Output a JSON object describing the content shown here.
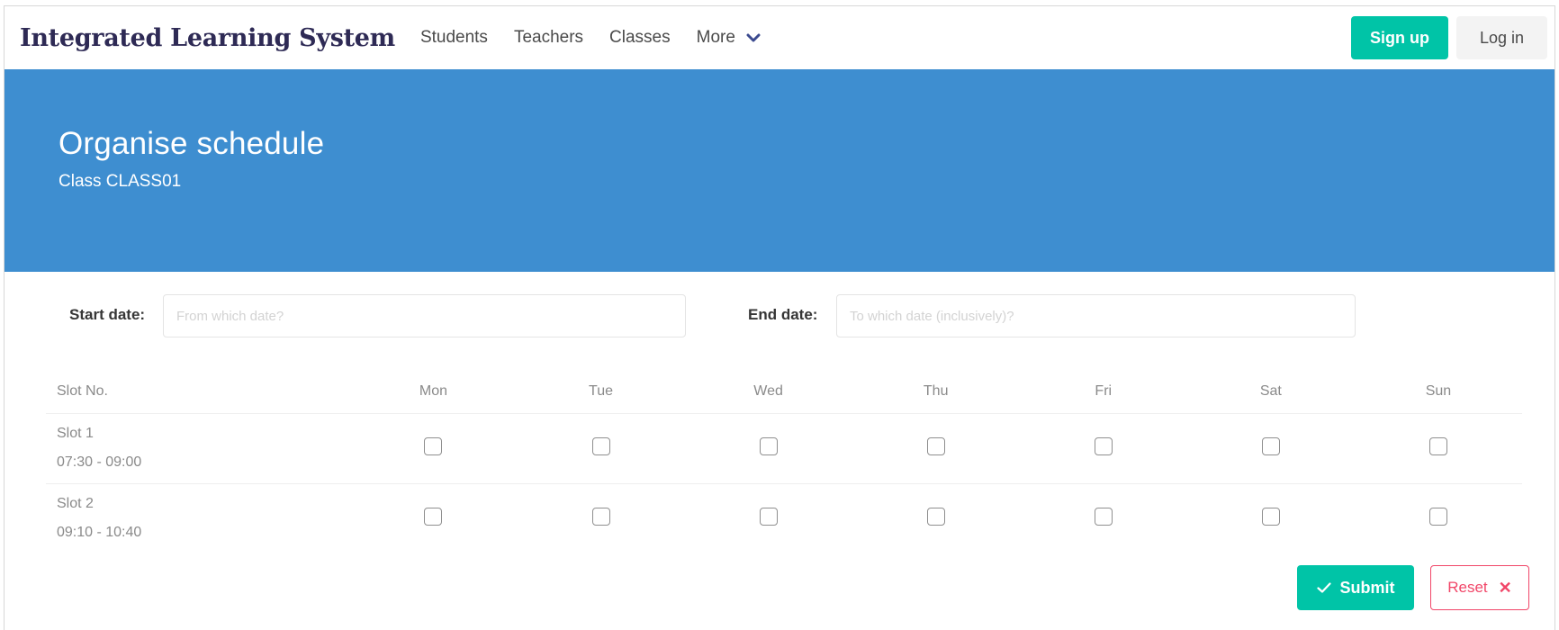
{
  "navbar": {
    "brand": "Integrated Learning System",
    "links": [
      "Students",
      "Teachers",
      "Classes"
    ],
    "more_label": "More",
    "signup_label": "Sign up",
    "login_label": "Log in"
  },
  "hero": {
    "title": "Organise schedule",
    "subtitle": "Class CLASS01"
  },
  "form": {
    "start_label": "Start date:",
    "start_placeholder": "From which date?",
    "end_label": "End date:",
    "end_placeholder": "To which date (inclusively)?"
  },
  "schedule": {
    "slot_header": "Slot No.",
    "days": [
      "Mon",
      "Tue",
      "Wed",
      "Thu",
      "Fri",
      "Sat",
      "Sun"
    ],
    "slots": [
      {
        "name": "Slot 1",
        "time": "07:30 - 09:00"
      },
      {
        "name": "Slot 2",
        "time": "09:10 - 10:40"
      }
    ]
  },
  "actions": {
    "submit_label": "Submit",
    "reset_label": "Reset"
  },
  "colors": {
    "primary": "#00c4a7",
    "hero": "#3e8ed0",
    "brand_text": "#2e2a55",
    "danger": "#f14668"
  }
}
